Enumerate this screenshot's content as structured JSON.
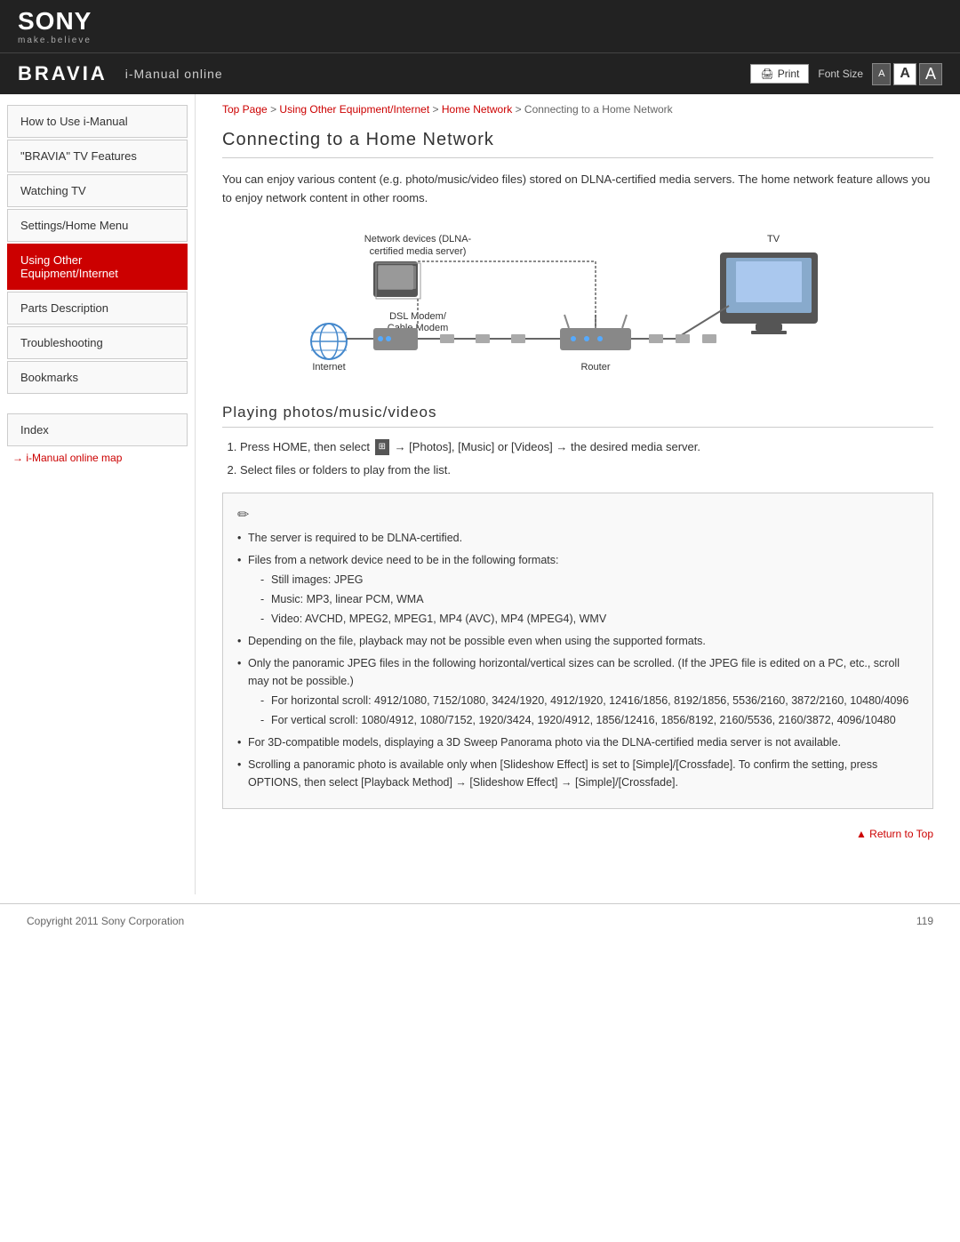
{
  "header": {
    "sony_logo": "SONY",
    "sony_tagline": "make.believe",
    "bravia_logo": "BRAVIA",
    "imanual_text": "i-Manual online",
    "print_label": "Print",
    "font_size_label": "Font Size",
    "font_size_small": "A",
    "font_size_medium": "A",
    "font_size_large": "A"
  },
  "breadcrumb": {
    "items": [
      "Top Page",
      "Using Other Equipment/Internet",
      "Home Network",
      "Connecting to a Home Network"
    ],
    "separator": " > "
  },
  "sidebar": {
    "items": [
      {
        "id": "how-to-use",
        "label": "How to Use i-Manual",
        "active": false
      },
      {
        "id": "bravia-features",
        "label": "\"BRAVIA\" TV Features",
        "active": false
      },
      {
        "id": "watching",
        "label": "Watching TV",
        "active": false
      },
      {
        "id": "settings",
        "label": "Settings/Home Menu",
        "active": false
      },
      {
        "id": "using-other",
        "label": "Using Other Equipment/Internet",
        "active": true
      },
      {
        "id": "parts",
        "label": "Parts Description",
        "active": false
      },
      {
        "id": "troubleshooting",
        "label": "Troubleshooting",
        "active": false
      },
      {
        "id": "bookmarks",
        "label": "Bookmarks",
        "active": false
      }
    ],
    "index_label": "Index",
    "map_link": "i-Manual online map"
  },
  "page": {
    "title": "Connecting to a Home Network",
    "intro": "You can enjoy various content (e.g. photo/music/video files) stored on DLNA-certified media servers. The home network feature allows you to enjoy network content in other rooms.",
    "diagram": {
      "labels": {
        "network_devices": "Network devices (DLNA-\ncertified media server)",
        "tv": "TV",
        "dsl_modem": "DSL Modem/\nCable Modem",
        "internet": "Internet",
        "router": "Router"
      }
    },
    "section2_title": "Playing photos/music/videos",
    "steps": [
      "Press HOME, then select  → [Photos], [Music] or [Videos] → the desired media server.",
      "Select files or folders to play from the list."
    ],
    "notes": [
      {
        "text": "The server is required to be DLNA-certified.",
        "subitems": []
      },
      {
        "text": "Files from a network device need to be in the following formats:",
        "subitems": [
          "Still images: JPEG",
          "Music: MP3, linear PCM, WMA",
          "Video: AVCHD, MPEG2, MPEG1, MP4 (AVC), MP4 (MPEG4), WMV"
        ]
      },
      {
        "text": "Depending on the file, playback may not be possible even when using the supported formats.",
        "subitems": []
      },
      {
        "text": "Only the panoramic JPEG files in the following horizontal/vertical sizes can be scrolled. (If the JPEG file is edited on a PC, etc., scroll may not be possible.)",
        "subitems": [
          "For horizontal scroll: 4912/1080, 7152/1080, 3424/1920, 4912/1920, 12416/1856, 8192/1856, 5536/2160, 3872/2160, 10480/4096",
          "For vertical scroll: 1080/4912, 1080/7152, 1920/3424, 1920/4912, 1856/12416, 1856/8192, 2160/5536, 2160/3872, 4096/10480"
        ]
      },
      {
        "text": "For 3D-compatible models, displaying a 3D Sweep Panorama photo via the DLNA-certified media server is not available.",
        "subitems": []
      },
      {
        "text": "Scrolling a panoramic photo is available only when [Slideshow Effect] is set to [Simple]/[Crossfade]. To confirm the setting, press OPTIONS, then select [Playback Method] → [Slideshow Effect] → [Simple]/[Crossfade].",
        "subitems": []
      }
    ],
    "return_top": "Return to Top"
  },
  "footer": {
    "copyright": "Copyright 2011 Sony Corporation",
    "page_number": "119"
  }
}
